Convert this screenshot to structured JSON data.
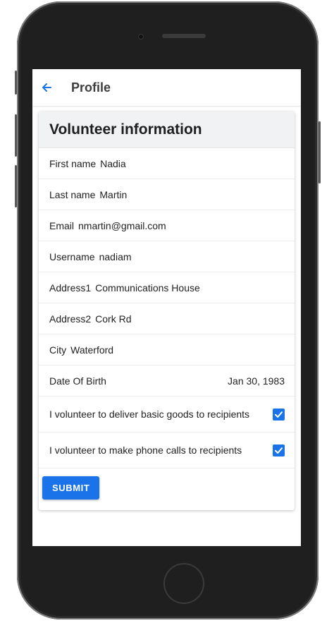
{
  "appbar": {
    "title": "Profile"
  },
  "form": {
    "header": "Volunteer information",
    "fields": [
      {
        "label": "First name",
        "value": "Nadia"
      },
      {
        "label": "Last name",
        "value": "Martin"
      },
      {
        "label": "Email",
        "value": "nmartin@gmail.com"
      },
      {
        "label": "Username",
        "value": "nadiam"
      },
      {
        "label": "Address1",
        "value": "Communications House"
      },
      {
        "label": "Address2",
        "value": "Cork Rd"
      },
      {
        "label": "City",
        "value": "Waterford"
      }
    ],
    "dob": {
      "label": "Date Of Birth",
      "value": "Jan 30, 1983"
    },
    "checks": [
      {
        "label": "I volunteer to deliver basic goods to recipients",
        "checked": true
      },
      {
        "label": "I volunteer to make phone calls to recipients",
        "checked": true
      }
    ],
    "submit_label": "SUBMIT"
  },
  "colors": {
    "accent": "#1a73e8",
    "phone_body": "#1f1f1f"
  },
  "icons": {
    "back": "arrow-left-icon",
    "check": "checkmark-icon"
  }
}
